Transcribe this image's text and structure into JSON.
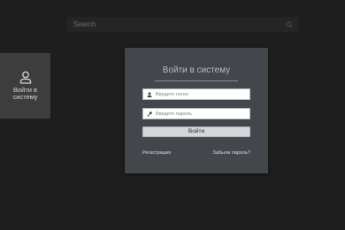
{
  "search": {
    "placeholder": "Search",
    "icon": "search-icon"
  },
  "sidebar": {
    "login_icon": "user-icon",
    "login_label": "Войти в системy"
  },
  "login_dialog": {
    "title": "Войти в систему",
    "login_field": {
      "icon": "user-icon",
      "placeholder": "Введите логин",
      "value": ""
    },
    "password_field": {
      "icon": "key-icon",
      "placeholder": "Введите пароль",
      "value": ""
    },
    "submit_label": "Войти",
    "register_link": "Регистрация",
    "forgot_link": "Забыли пароль?"
  },
  "colors": {
    "background": "#1e1e1e",
    "dialog": "#43474c",
    "sidebar": "#3d3d3d",
    "button": "#d4d6d9"
  }
}
